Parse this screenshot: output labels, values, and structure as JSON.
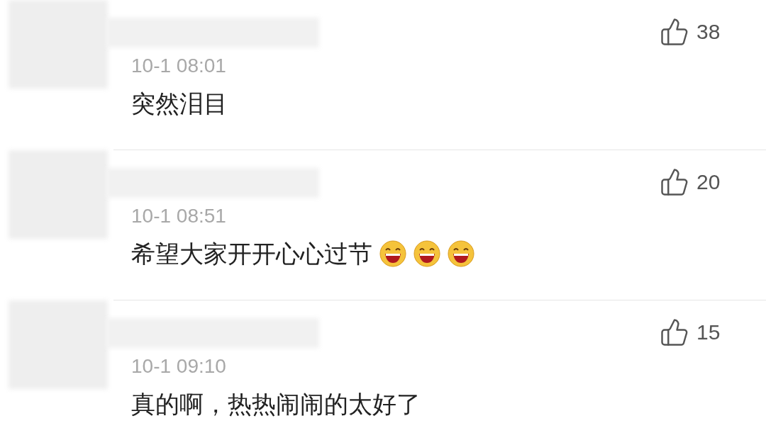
{
  "comments": [
    {
      "likes": "38",
      "time": "10-1 08:01",
      "text": "突然泪目"
    },
    {
      "likes": "20",
      "time": "10-1 08:51",
      "text": "希望大家开开心心过节",
      "emojis": [
        {
          "kind": "laugh"
        },
        {
          "kind": "laugh"
        },
        {
          "kind": "laugh"
        }
      ]
    },
    {
      "likes": "15",
      "time": "10-1 09:10",
      "text": "真的啊，热热闹闹的太好了"
    }
  ]
}
